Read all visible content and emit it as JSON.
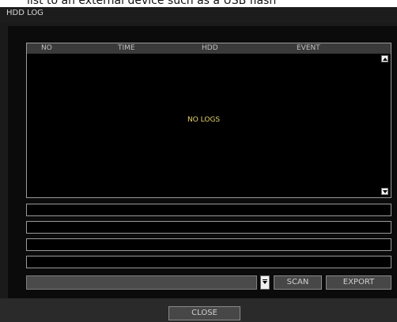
{
  "page_caption": "list to an external device such as a USB flash",
  "window": {
    "title": "HDD LOG"
  },
  "log_table": {
    "columns": [
      "NO",
      "TIME",
      "HDD",
      "EVENT"
    ],
    "rows": [],
    "empty_message": "NO LOGS"
  },
  "detail_fields": [
    "",
    "",
    "",
    ""
  ],
  "device_select": {
    "value": ""
  },
  "buttons": {
    "scan": "SCAN",
    "export": "EXPORT",
    "close": "CLOSE"
  },
  "icons": {
    "scroll_up": "scroll-up-arrow-icon",
    "scroll_down": "scroll-down-arrow-icon",
    "dropdown": "dropdown-arrow-icon"
  },
  "colors": {
    "empty_message": "#e3d26a",
    "panel_background": "#000000",
    "button_background": "#474747"
  }
}
